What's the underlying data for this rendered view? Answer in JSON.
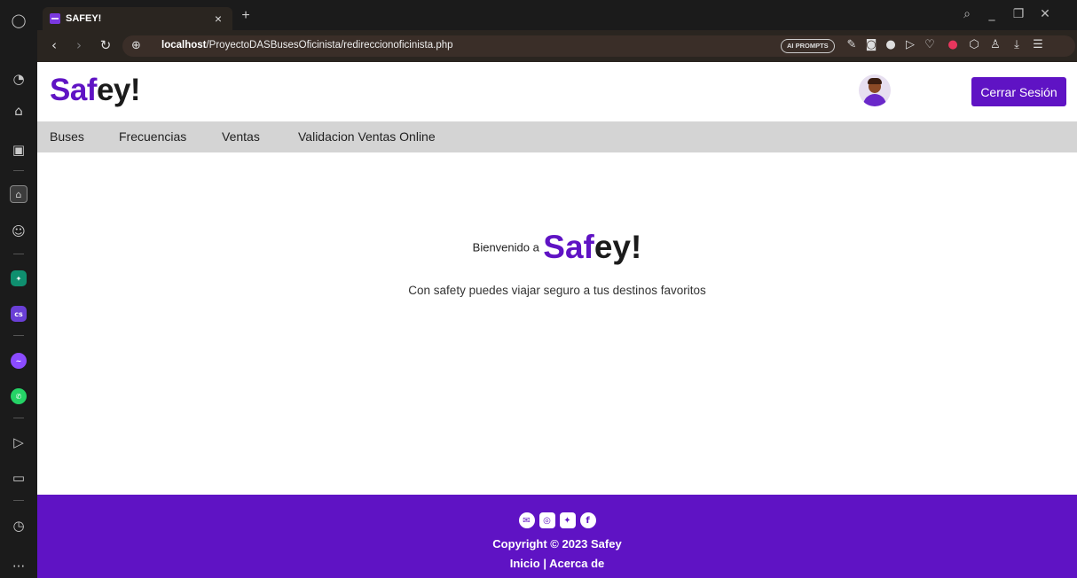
{
  "browser": {
    "tab_title": "SAFEY!",
    "tab_close": "×",
    "new_tab": "+",
    "url_host": "localhost",
    "url_path": "/ProyectoDASBusesOficinista/redireccionoficinista.php",
    "ai_prompts": "AI PROMPTS"
  },
  "header": {
    "logo_accent": "Saf",
    "logo_rest": "ey!",
    "logout_label": "Cerrar Sesión"
  },
  "nav": {
    "items": [
      {
        "label": "Buses"
      },
      {
        "label": "Frecuencias"
      },
      {
        "label": "Ventas"
      },
      {
        "label": "Validacion Ventas Online"
      }
    ]
  },
  "main": {
    "welcome_prefix": "Bienvenido a",
    "brand_accent": "Saf",
    "brand_rest": "ey!",
    "tagline": "Con safety puedes viajar seguro a tus destinos favoritos"
  },
  "footer": {
    "copyright": "Copyright © 2023 Safey",
    "link_home": "Inicio",
    "separator": "|",
    "link_about": "Acerca de"
  },
  "colors": {
    "brand": "#5f13c4",
    "nav_bg": "#d4d4d4",
    "browser_bg": "#1b1b1b"
  }
}
